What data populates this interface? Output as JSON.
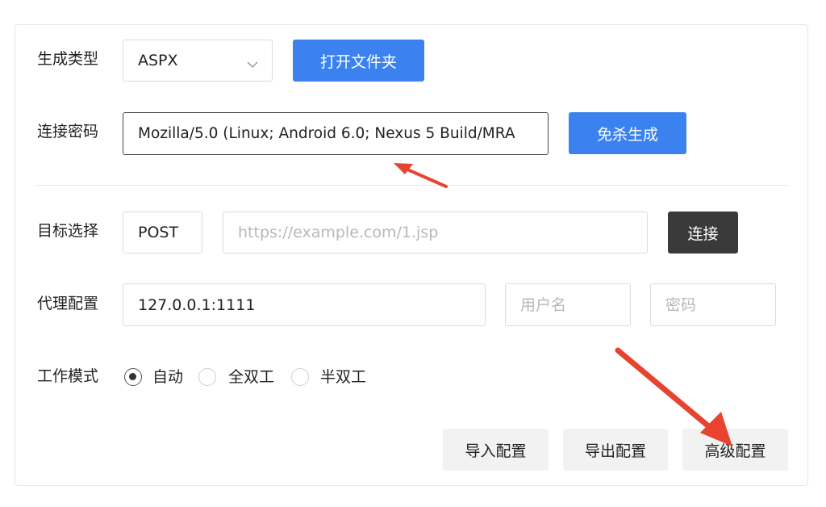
{
  "form": {
    "gen_type": {
      "label": "生成类型",
      "value": "ASPX"
    },
    "open_folder_button": "打开文件夹",
    "conn_password": {
      "label": "连接密码",
      "value": "Mozilla/5.0 (Linux; Android 6.0; Nexus 5 Build/MRA"
    },
    "evade_generate_button": "免杀生成",
    "target": {
      "label": "目标选择",
      "method": "POST",
      "url_placeholder": "https://example.com/1.jsp"
    },
    "connect_button": "连接",
    "proxy": {
      "label": "代理配置",
      "address": "127.0.0.1:1111",
      "username_placeholder": "用户名",
      "password_placeholder": "密码"
    },
    "work_mode": {
      "label": "工作模式",
      "options": [
        "自动",
        "全双工",
        "半双工"
      ],
      "selected": "自动"
    },
    "footer_buttons": {
      "import": "导入配置",
      "export": "导出配置",
      "advanced": "高级配置"
    }
  },
  "colors": {
    "primary": "#3b82f0",
    "dark_button": "#3a3a3a",
    "annotation_arrow": "#e8432f"
  }
}
